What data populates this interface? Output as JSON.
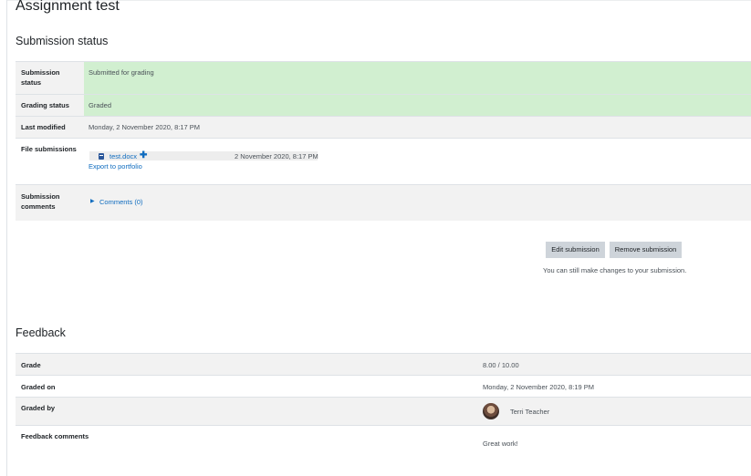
{
  "page": {
    "title": "Assignment test"
  },
  "submission": {
    "heading": "Submission status",
    "rows": {
      "status": {
        "label_line1": "Submission",
        "label_line2": "status",
        "value": "Submitted for grading"
      },
      "grading": {
        "label": "Grading status",
        "value": "Graded"
      },
      "modified": {
        "label": "Last modified",
        "value": "Monday, 2 November 2020, 8:17 PM"
      },
      "files": {
        "label": "File submissions",
        "file_name": "test.docx",
        "file_icon": "word-document-icon",
        "file_date": "2 November 2020, 8:17 PM",
        "export_link": "Export to portfolio"
      },
      "comments": {
        "label_line1": "Submission",
        "label_line2": "comments",
        "link": "Comments (0)"
      }
    },
    "buttons": {
      "edit": "Edit submission",
      "remove": "Remove submission"
    },
    "note": "You can still make changes to your submission."
  },
  "feedback": {
    "heading": "Feedback",
    "rows": {
      "grade": {
        "label": "Grade",
        "value": "8.00 / 10.00"
      },
      "graded_on": {
        "label": "Graded on",
        "value": "Monday, 2 November 2020, 8:19 PM"
      },
      "graded_by": {
        "label": "Graded by",
        "name": "Terri Teacher"
      },
      "comments": {
        "label": "Feedback comments",
        "value": "Great work!"
      }
    }
  },
  "colors": {
    "success_bg": "#d1efd0",
    "row_bg": "#f2f2f2",
    "link": "#0f6cbf",
    "button_bg": "#ced4da"
  }
}
